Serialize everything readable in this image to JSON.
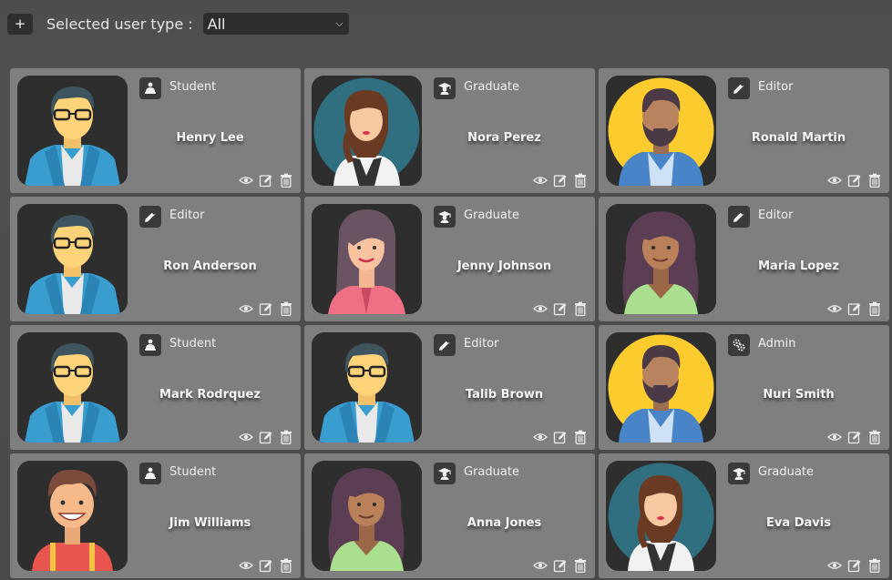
{
  "toolbar": {
    "add_label": "+",
    "filter_label": "Selected user type :",
    "filter_value": "All"
  },
  "users": [
    {
      "name": "Henry Lee",
      "role": "Student",
      "role_icon": "student-icon",
      "avatar": "man-glasses-avatar"
    },
    {
      "name": "Nora Perez",
      "role": "Graduate",
      "role_icon": "graduation-cap-icon",
      "avatar": "woman-teal-avatar"
    },
    {
      "name": "Ronald Martin",
      "role": "Editor",
      "role_icon": "pencil-icon",
      "avatar": "bearded-man-avatar"
    },
    {
      "name": "Ron Anderson",
      "role": "Editor",
      "role_icon": "pencil-icon",
      "avatar": "man-glasses-avatar"
    },
    {
      "name": "Jenny Johnson",
      "role": "Graduate",
      "role_icon": "graduation-cap-icon",
      "avatar": "woman-purple-hair-avatar"
    },
    {
      "name": "Maria Lopez",
      "role": "Editor",
      "role_icon": "pencil-icon",
      "avatar": "woman-curly-hair-avatar"
    },
    {
      "name": "Mark Rodrquez",
      "role": "Student",
      "role_icon": "student-icon",
      "avatar": "man-glasses-avatar"
    },
    {
      "name": "Talib Brown",
      "role": "Editor",
      "role_icon": "pencil-icon",
      "avatar": "man-glasses-avatar"
    },
    {
      "name": "Nuri Smith",
      "role": "Admin",
      "role_icon": "admin-gears-icon",
      "avatar": "bearded-man-avatar"
    },
    {
      "name": "Jim Williams",
      "role": "Student",
      "role_icon": "student-icon",
      "avatar": "smiling-man-avatar"
    },
    {
      "name": "Anna Jones",
      "role": "Graduate",
      "role_icon": "graduation-cap-icon",
      "avatar": "woman-curly-hair-avatar"
    },
    {
      "name": "Eva Davis",
      "role": "Graduate",
      "role_icon": "graduation-cap-icon",
      "avatar": "woman-teal-avatar"
    }
  ],
  "card_actions": [
    "view-eye-icon",
    "edit-icon",
    "delete-trash-icon"
  ]
}
